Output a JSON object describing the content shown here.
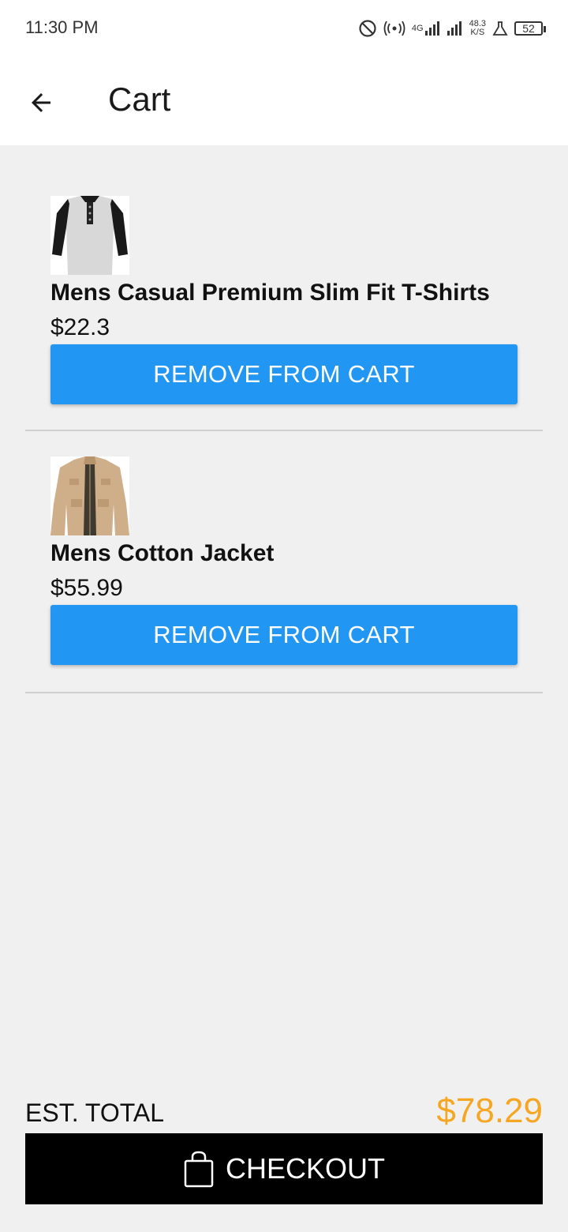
{
  "status_bar": {
    "time": "11:30 PM",
    "network_type": "4G",
    "net_speed_value": "48.3",
    "net_speed_unit": "K/S",
    "battery": "52",
    "icons": [
      "do-not-disturb-icon",
      "hotspot-icon",
      "signal-4g-icon",
      "signal-icon",
      "lab-icon",
      "battery-icon"
    ]
  },
  "header": {
    "back_icon": "arrow-left-icon",
    "title": "Cart"
  },
  "cart": {
    "items": [
      {
        "name": "Mens Casual Premium Slim Fit T-Shirts",
        "price": "$22.3",
        "image": "tshirt-image",
        "remove_label": "REMOVE FROM CART"
      },
      {
        "name": "Mens Cotton Jacket",
        "price": "$55.99",
        "image": "jacket-image",
        "remove_label": "REMOVE FROM CART"
      }
    ]
  },
  "summary": {
    "total_label": "EST. TOTAL",
    "total_value": "$78.29",
    "checkout_label": "CHECKOUT",
    "checkout_icon": "shopping-bag-icon"
  },
  "colors": {
    "accent_blue": "#2196f3",
    "total_orange": "#f5a623",
    "checkout_black": "#000000",
    "background": "#f0f0f0"
  }
}
